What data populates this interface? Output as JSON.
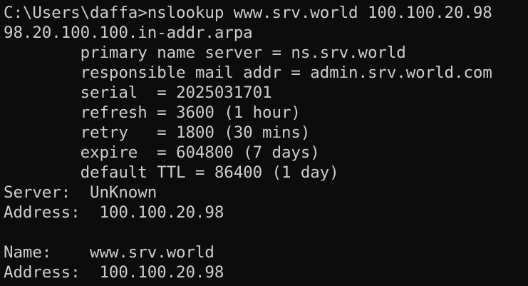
{
  "terminal": {
    "lines": [
      "C:\\Users\\daffa>nslookup www.srv.world 100.100.20.98",
      "98.20.100.100.in-addr.arpa",
      "        primary name server = ns.srv.world",
      "        responsible mail addr = admin.srv.world.com",
      "        serial  = 2025031701",
      "        refresh = 3600 (1 hour)",
      "        retry   = 1800 (30 mins)",
      "        expire  = 604800 (7 days)",
      "        default TTL = 86400 (1 day)",
      "Server:  UnKnown",
      "Address:  100.100.20.98",
      "",
      "Name:    www.srv.world",
      "Address:  100.100.20.98"
    ],
    "background": "#0c0c0c",
    "foreground": "#cccccc"
  }
}
